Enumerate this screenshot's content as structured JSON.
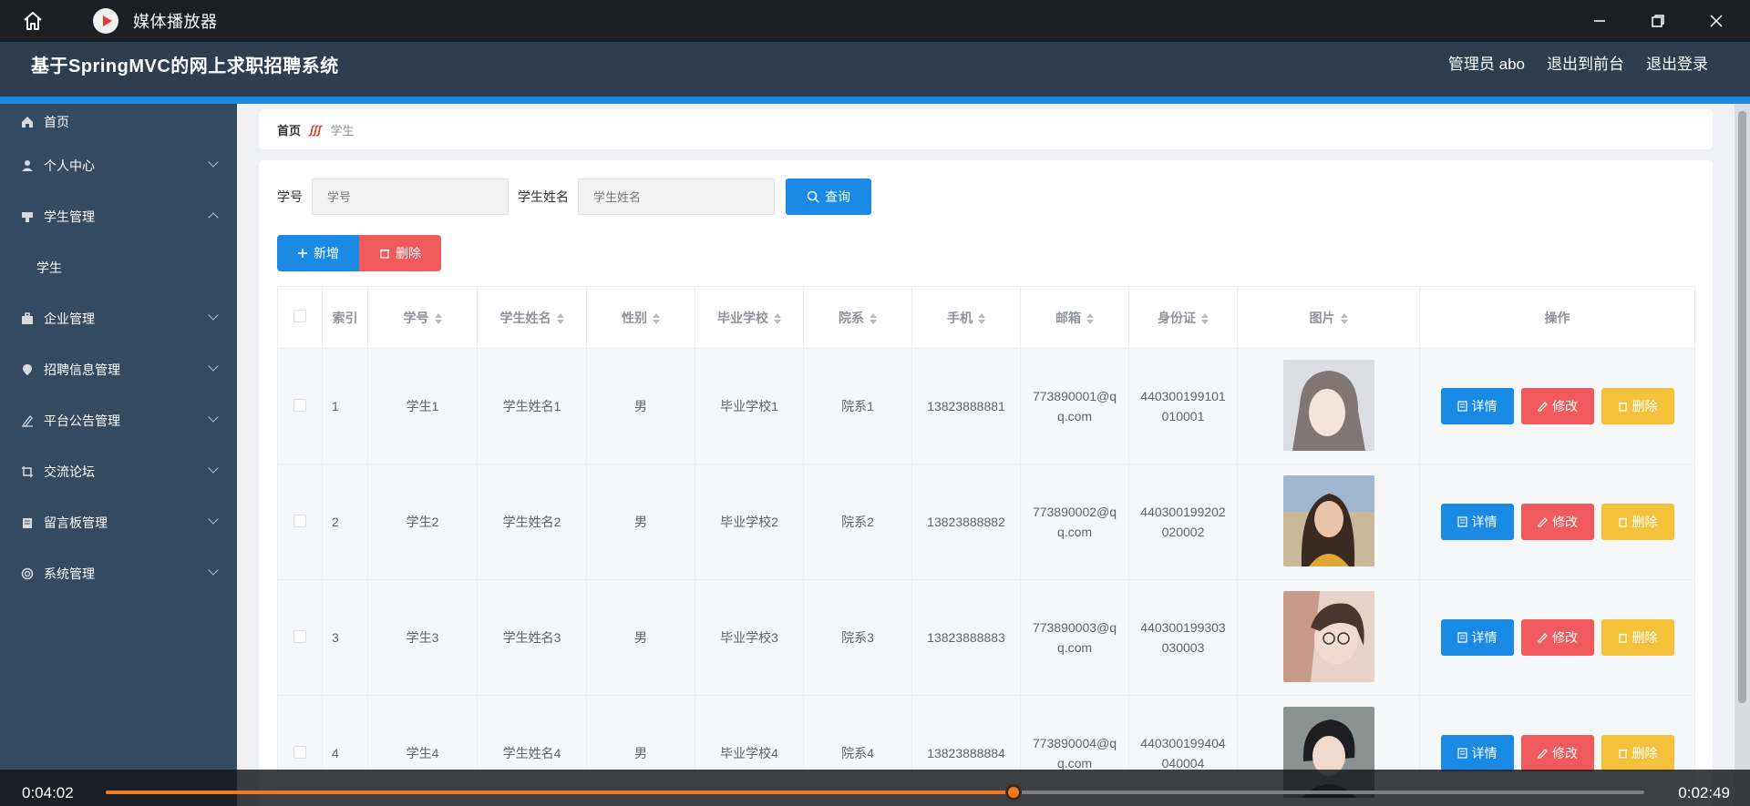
{
  "player": {
    "title": "媒体播放器",
    "elapsed": "0:04:02",
    "remaining": "0:02:49",
    "progress_fraction": 0.59,
    "icons": {
      "home": "home-icon",
      "app": "media-player-icon",
      "minimize": "minimize-icon",
      "restore": "restore-icon",
      "close": "close-icon"
    }
  },
  "header": {
    "title": "基于SpringMVC的网上求职招聘系统",
    "admin": "管理员 abo",
    "to_front": "退出到前台",
    "logout": "退出登录"
  },
  "sidebar": {
    "items": [
      {
        "label": "首页",
        "icon": "home-icon",
        "expandable": false
      },
      {
        "label": "个人中心",
        "icon": "user-icon",
        "expandable": true
      },
      {
        "label": "学生管理",
        "icon": "student-manage-icon",
        "expandable": true,
        "expanded": true
      },
      {
        "label": "学生",
        "sub": true
      },
      {
        "label": "企业管理",
        "icon": "briefcase-icon",
        "expandable": true
      },
      {
        "label": "招聘信息管理",
        "icon": "location-icon",
        "expandable": true
      },
      {
        "label": "平台公告管理",
        "icon": "edit-icon",
        "expandable": true
      },
      {
        "label": "交流论坛",
        "icon": "crop-icon",
        "expandable": true
      },
      {
        "label": "留言板管理",
        "icon": "message-board-icon",
        "expandable": true
      },
      {
        "label": "系统管理",
        "icon": "settings-icon",
        "expandable": true
      }
    ]
  },
  "breadcrumb": {
    "home": "首页",
    "separator": "ʃʃʃ",
    "current": "学生"
  },
  "search": {
    "id_label": "学号",
    "id_placeholder": "学号",
    "name_label": "学生姓名",
    "name_placeholder": "学生姓名",
    "query_label": "查询"
  },
  "actions": {
    "add_label": "新增",
    "delete_label": "删除"
  },
  "table": {
    "columns": [
      "索引",
      "学号",
      "学生姓名",
      "性别",
      "毕业学校",
      "院系",
      "手机",
      "邮箱",
      "身份证",
      "图片",
      "操作"
    ],
    "rows": [
      {
        "index": "1",
        "id": "学生1",
        "name": "学生姓名1",
        "gender": "男",
        "school": "毕业学校1",
        "dept": "院系1",
        "phone": "13823888881",
        "email": "773890001@qq.com",
        "idcard": "440300199101010001"
      },
      {
        "index": "2",
        "id": "学生2",
        "name": "学生姓名2",
        "gender": "男",
        "school": "毕业学校2",
        "dept": "院系2",
        "phone": "13823888882",
        "email": "773890002@qq.com",
        "idcard": "440300199202020002"
      },
      {
        "index": "3",
        "id": "学生3",
        "name": "学生姓名3",
        "gender": "男",
        "school": "毕业学校3",
        "dept": "院系3",
        "phone": "13823888883",
        "email": "773890003@qq.com",
        "idcard": "440300199303030003"
      },
      {
        "index": "4",
        "id": "学生4",
        "name": "学生姓名4",
        "gender": "男",
        "school": "毕业学校4",
        "dept": "院系4",
        "phone": "13823888884",
        "email": "773890004@qq.com",
        "idcard": "440300199404040004"
      }
    ],
    "op_labels": {
      "detail": "详情",
      "edit": "修改",
      "remove": "删除"
    }
  },
  "colors": {
    "header": "#2c3e50",
    "sidebar": "#334a60",
    "accent": "#1a8ae5",
    "danger": "#f15a5c",
    "warning": "#f4c13a",
    "progress": "#f07a22"
  }
}
